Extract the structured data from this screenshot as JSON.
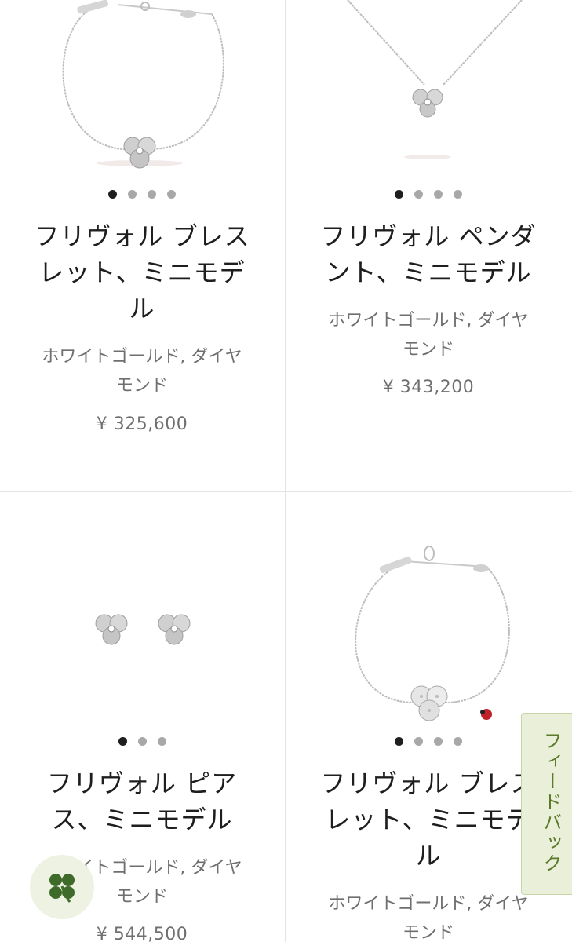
{
  "products": [
    {
      "title": "フリヴォル ブレスレット、ミニモデル",
      "title_lines": [
        "フリヴォル ブレス",
        "レット、ミニモデ",
        "ル"
      ],
      "material_lines": [
        "ホワイトゴールド, ダイヤ",
        "モンド"
      ],
      "price": "¥ 325,600",
      "image": "bracelet-icon",
      "dots": 4,
      "active_dot": 1
    },
    {
      "title": "フリヴォル ペンダント、ミニモデル",
      "title_lines": [
        "フリヴォル ペンダ",
        "ント、ミニモデル"
      ],
      "material_lines": [
        "ホワイトゴールド, ダイヤ",
        "モンド"
      ],
      "price": "¥ 343,200",
      "image": "pendant-icon",
      "dots": 4,
      "active_dot": 1
    },
    {
      "title": "フリヴォル ピアス、ミニモデル",
      "title_lines": [
        "フリヴォル ピア",
        "ス、ミニモデル"
      ],
      "material_lines": [
        "ホワイトゴールド, ダイヤ",
        "モンド"
      ],
      "price": "¥ 544,500",
      "image": "earrings-icon",
      "dots": 3,
      "active_dot": 1
    },
    {
      "title": "フリヴォル ブレスレット、ミニモデル",
      "title_lines": [
        "フリヴォル ブレス",
        "レット、ミニモデ",
        "ル"
      ],
      "material_lines": [
        "ホワイトゴールド, ダイヤ",
        "モンド"
      ],
      "price": "",
      "image": "diamond-bracelet-icon",
      "dots": 4,
      "active_dot": 1
    }
  ],
  "feedback_tab": {
    "label": "フィードバック"
  },
  "floating_button": {
    "icon": "clover-icon"
  },
  "colors": {
    "accent": "#5a7a2a",
    "feedback_bg": "#e9efd8",
    "dot_active": "#1e1e1e",
    "dot_inactive": "#a8a8a8"
  }
}
